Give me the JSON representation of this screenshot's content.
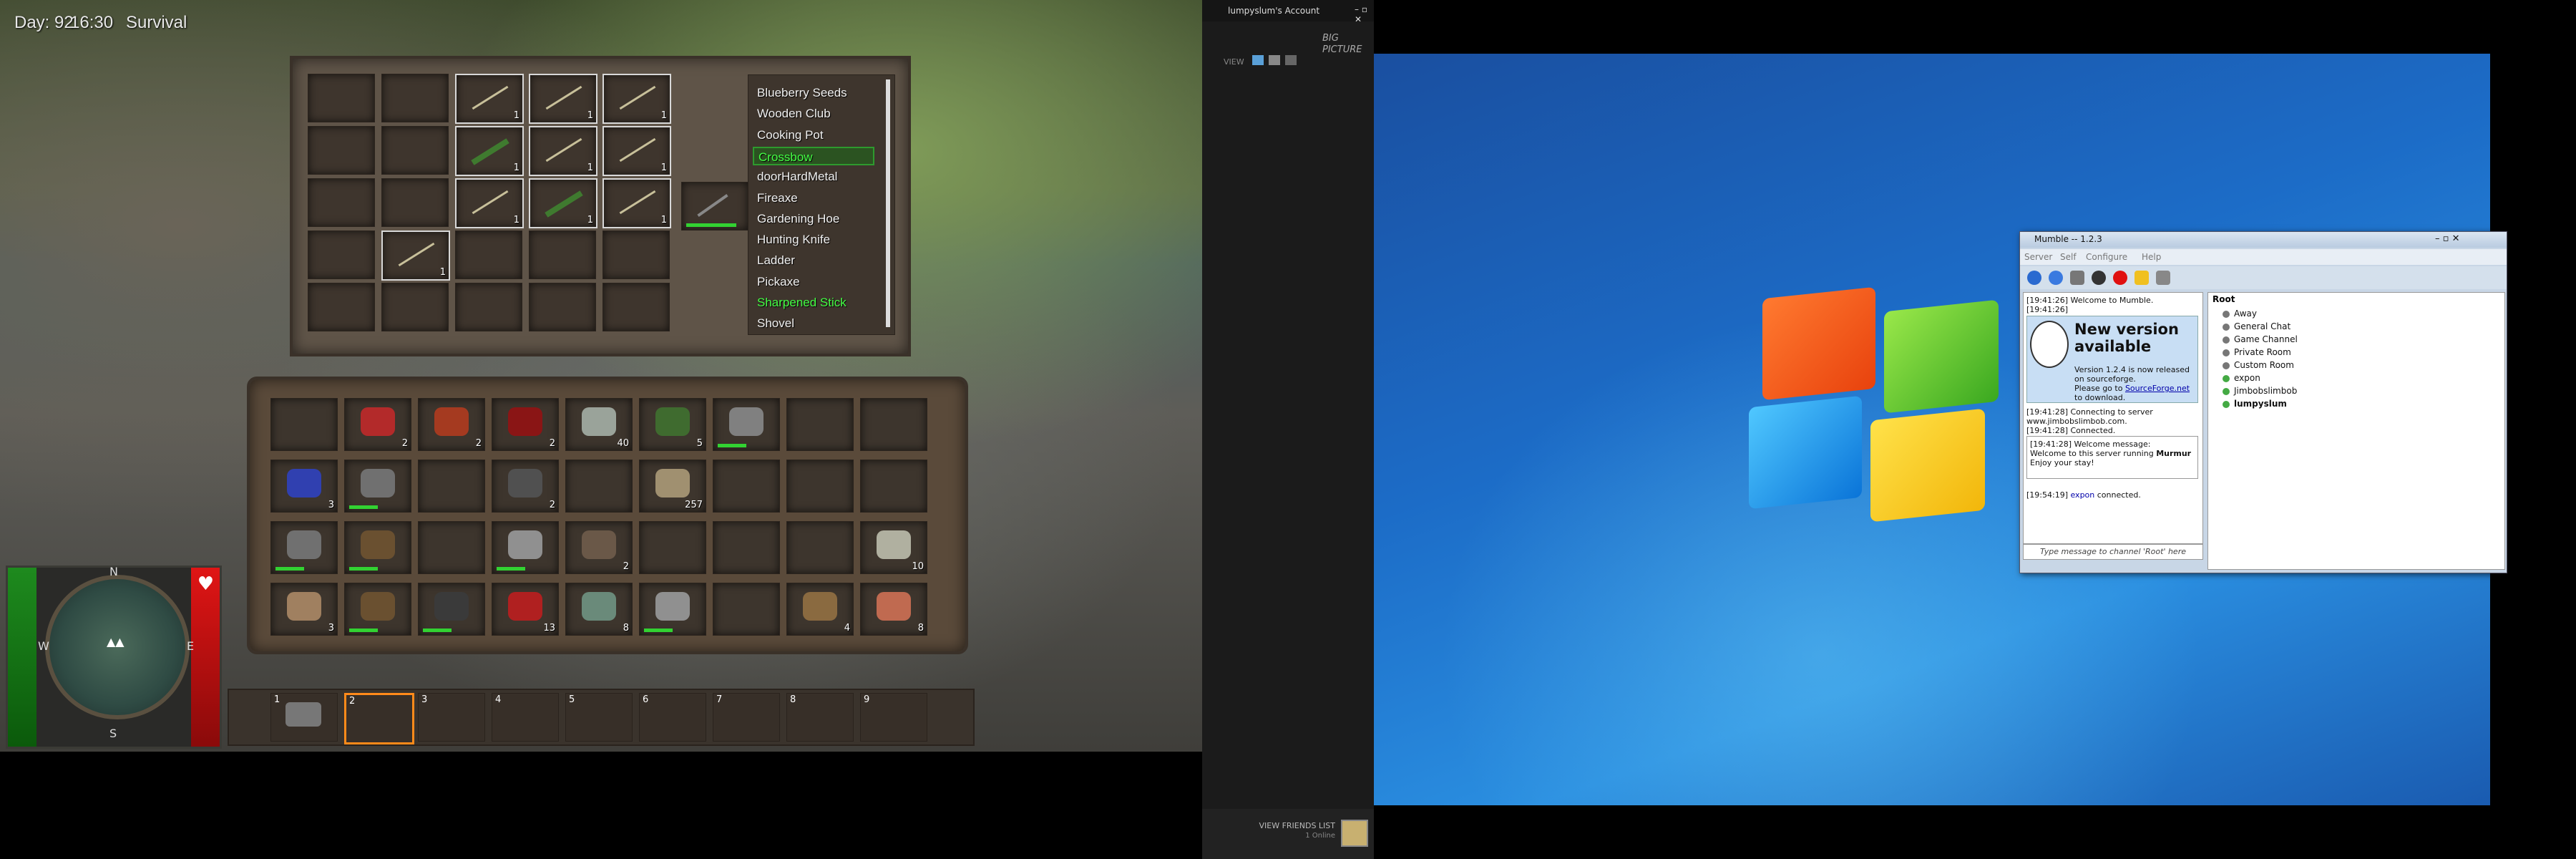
{
  "game": {
    "hud_day": "Day: 92",
    "hud_time": "16:30",
    "hud_mode": "Survival",
    "crafting_grid": {
      "rows": [
        [
          {
            "c": ""
          },
          {
            "c": ""
          },
          {
            "c": "1",
            "item": "stick"
          },
          {
            "c": "1",
            "item": "stick"
          },
          {
            "c": "1",
            "item": "stick"
          }
        ],
        [
          {
            "c": ""
          },
          {
            "c": ""
          },
          {
            "c": "1",
            "item": "plant"
          },
          {
            "c": "1",
            "item": "stick"
          },
          {
            "c": "1",
            "item": "stick"
          }
        ],
        [
          {
            "c": ""
          },
          {
            "c": ""
          },
          {
            "c": "1",
            "item": "stick"
          },
          {
            "c": "1",
            "item": "plant"
          },
          {
            "c": "1",
            "item": "stick"
          }
        ],
        [
          {
            "c": ""
          },
          {
            "c": "1",
            "item": "stick"
          },
          {
            "c": ""
          },
          {
            "c": ""
          },
          {
            "c": ""
          }
        ],
        [
          {
            "c": ""
          },
          {
            "c": ""
          },
          {
            "c": ""
          },
          {
            "c": ""
          },
          {
            "c": ""
          }
        ]
      ],
      "result_item": "crossbow"
    },
    "recipes": [
      {
        "label": "Blueberry Seeds",
        "state": "normal"
      },
      {
        "label": "Wooden Club",
        "state": "normal"
      },
      {
        "label": "Cooking Pot",
        "state": "normal"
      },
      {
        "label": "Crossbow",
        "state": "selected"
      },
      {
        "label": "doorHardMetal",
        "state": "normal"
      },
      {
        "label": "Fireaxe",
        "state": "normal"
      },
      {
        "label": "Gardening Hoe",
        "state": "normal"
      },
      {
        "label": "Hunting Knife",
        "state": "normal"
      },
      {
        "label": "Ladder",
        "state": "normal"
      },
      {
        "label": "Pickaxe",
        "state": "normal"
      },
      {
        "label": "Sharpened Stick",
        "state": "green"
      },
      {
        "label": "Shovel",
        "state": "normal"
      }
    ],
    "inventory_rows": [
      [
        {
          "c": ""
        },
        {
          "c": "2",
          "color": "#b32a2a"
        },
        {
          "c": "2",
          "color": "#a53a20"
        },
        {
          "c": "2",
          "color": "#8a1515"
        },
        {
          "c": "40",
          "color": "#9aa39a"
        },
        {
          "c": "5",
          "color": "#3f6b2f"
        },
        {
          "c": "",
          "color": "#808080",
          "bar": true
        },
        {
          "c": ""
        },
        {
          "c": ""
        }
      ],
      [
        {
          "c": "3",
          "color": "#3040b0"
        },
        {
          "c": "",
          "color": "#707070",
          "bar": true
        },
        {
          "c": ""
        },
        {
          "c": "2",
          "color": "#505050"
        },
        {
          "c": ""
        },
        {
          "c": "257",
          "color": "#a09070"
        },
        {
          "c": ""
        },
        {
          "c": ""
        },
        {
          "c": ""
        }
      ],
      [
        {
          "c": "",
          "color": "#707070",
          "bar": true
        },
        {
          "c": "",
          "color": "#6a5030",
          "bar": true
        },
        {
          "c": ""
        },
        {
          "c": "",
          "color": "#909090",
          "bar": true
        },
        {
          "c": "2",
          "color": "#6a5848"
        },
        {
          "c": ""
        },
        {
          "c": ""
        },
        {
          "c": ""
        },
        {
          "c": "10",
          "color": "#b0b0a0"
        }
      ],
      [
        {
          "c": "3",
          "color": "#a08060"
        },
        {
          "c": "",
          "color": "#6a5030",
          "bar": true
        },
        {
          "c": "",
          "color": "#3a3a3a",
          "bar": true
        },
        {
          "c": "13",
          "color": "#b02020"
        },
        {
          "c": "8",
          "color": "#6a8a7a"
        },
        {
          "c": "",
          "color": "#909090",
          "bar": true
        },
        {
          "c": ""
        },
        {
          "c": "4",
          "color": "#8a6a40"
        },
        {
          "c": "8",
          "color": "#c06a50"
        }
      ]
    ],
    "belt": [
      {
        "n": "1",
        "item": true
      },
      {
        "n": "2",
        "selected": true
      },
      {
        "n": "3"
      },
      {
        "n": "4"
      },
      {
        "n": "5"
      },
      {
        "n": "6"
      },
      {
        "n": "7"
      },
      {
        "n": "8"
      },
      {
        "n": "9"
      }
    ],
    "compass_letters": [
      "N",
      "E",
      "S",
      "W"
    ]
  },
  "steam": {
    "account_label": "lumpyslum's Account",
    "big_picture": "BIG\nPICTURE",
    "view_label": "VIEW",
    "friends_label": "VIEW FRIENDS LIST",
    "friends_online": "1 Online"
  },
  "mumble": {
    "title": "Mumble -- 1.2.3",
    "menu": [
      "Server",
      "Self",
      "Configure",
      "Help"
    ],
    "log": [
      "[19:41:26] Welcome to Mumble.",
      "[19:41:26]"
    ],
    "new_version_title": "New version available",
    "new_version_body": "Version 1.2.4 is now released on sourceforge.",
    "new_version_goto": "Please go to ",
    "new_version_link": "SourceForge.net",
    "new_version_tail": " to download.",
    "log2": [
      "[19:41:28] Connecting to server",
      "www.jimbobslimbob.com.",
      "[19:41:28] Connected."
    ],
    "welcome_box": [
      "[19:41:28] Welcome message:",
      "Welcome to this server running ",
      "Murmur",
      "Enjoy your stay!"
    ],
    "connect_time": "[19:54:19] ",
    "connect_user": "expon",
    "connect_tail": " connected.",
    "input_placeholder": "Type message to channel 'Root' here",
    "tree_root": "Root",
    "channels": [
      "Away",
      "General Chat",
      "Game Channel",
      "Private Room",
      "Custom Room"
    ],
    "users": [
      "expon",
      "Jimbobslimbob",
      "lumpyslum"
    ]
  }
}
